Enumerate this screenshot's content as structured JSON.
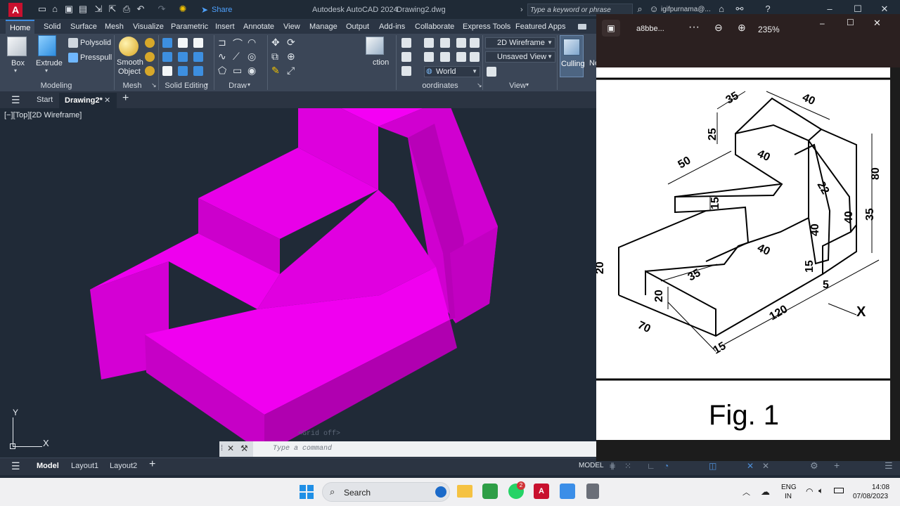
{
  "app": {
    "title": "Autodesk AutoCAD 2024",
    "drawing": "Drawing2.dwg",
    "search_placeholder": "Type a keyword or phrase",
    "user": "igifpurnama@...",
    "share": "Share"
  },
  "ribbon_tabs": [
    "Home",
    "Solid",
    "Surface",
    "Mesh",
    "Visualize",
    "Parametric",
    "Insert",
    "Annotate",
    "View",
    "Manage",
    "Output",
    "Add-ins",
    "Collaborate",
    "Express Tools",
    "Featured Apps"
  ],
  "ribbon": {
    "box": "Box",
    "extrude": "Extrude",
    "polysolid": "Polysolid",
    "presspull": "Presspull",
    "smooth": "Smooth",
    "object": "Object",
    "modeling": "Modeling",
    "mesh": "Mesh",
    "solid_editing": "Solid Editing",
    "draw": "Draw",
    "section": "ction",
    "coordinates": "oordinates",
    "view": "View",
    "visual_style": "2D Wireframe",
    "named_view": "Unsaved View",
    "ucs": "World",
    "culling": "Culling",
    "ne": "Ne"
  },
  "doc_tabs": {
    "start": "Start",
    "drawing": "Drawing2*"
  },
  "viewport": {
    "label": "[−][Top][2D Wireframe]",
    "grid_tip": "<Grid off>",
    "cmd_placeholder": "Type a command",
    "axis_x": "X",
    "axis_y": "Y",
    "accent": "#ee00ee"
  },
  "layouts": [
    "Model",
    "Layout1",
    "Layout2"
  ],
  "status": {
    "model": "MODEL"
  },
  "viewer": {
    "filename": "a8bbe...",
    "zoom": "235%",
    "figure_caption": "Fig. 1",
    "dims": [
      "35",
      "40",
      "25",
      "50",
      "40",
      "80",
      "15",
      "35",
      "20",
      "40",
      "35",
      "20",
      "120",
      "70",
      "15",
      "5",
      "X",
      "40",
      "22",
      "40",
      "15"
    ]
  },
  "taskbar": {
    "search": "Search",
    "lang": "ENG",
    "region": "IN",
    "time": "14:08",
    "date": "07/08/2023",
    "badge": "2"
  }
}
